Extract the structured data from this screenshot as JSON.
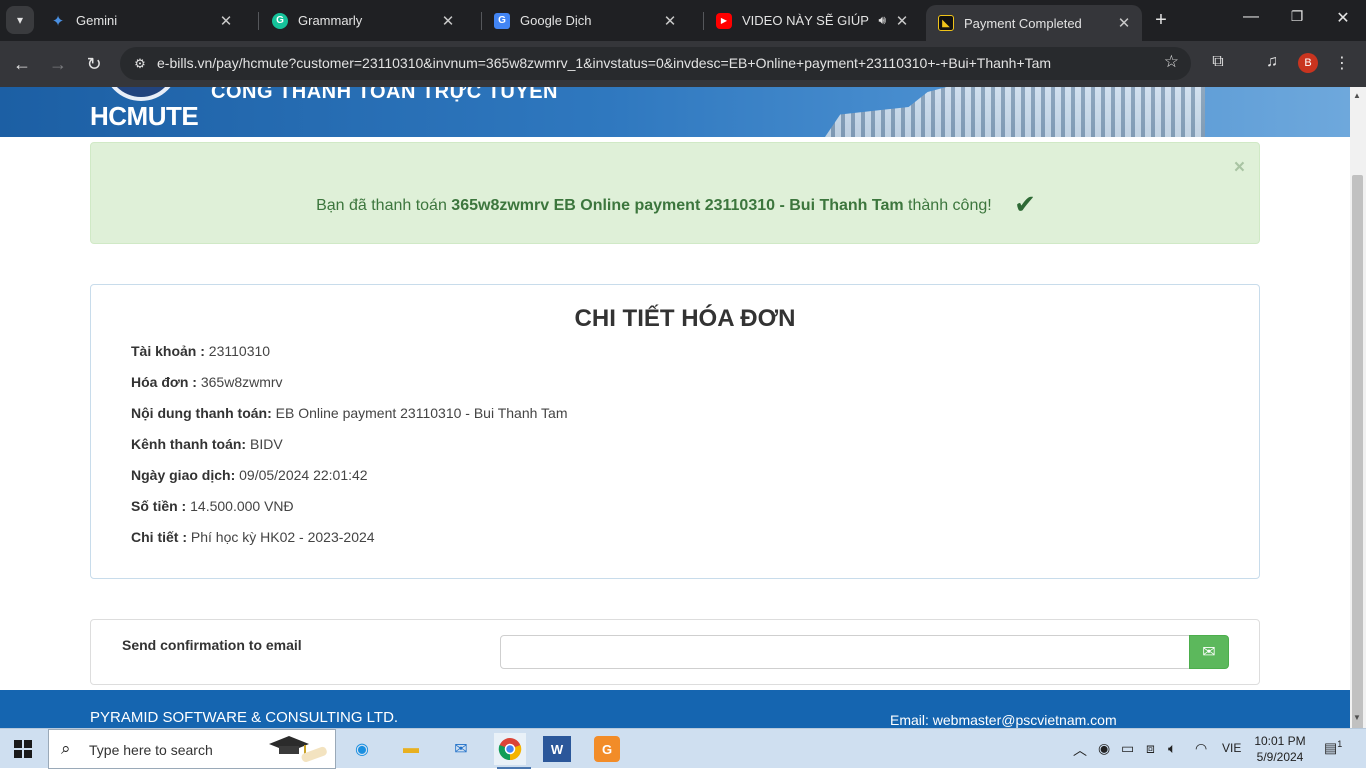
{
  "browser": {
    "tabs": [
      {
        "label": "Gemini",
        "icon": "gemini-sparkle-icon",
        "color": "#4a90e2",
        "active": false
      },
      {
        "label": "Grammarly",
        "icon": "grammarly-icon",
        "color": "#15c39a",
        "active": false
      },
      {
        "label": "Google Dịch",
        "icon": "google-translate-icon",
        "color": "#4285f4",
        "active": false
      },
      {
        "label": "VIDEO NÀY SẼ GIÚP BẠN",
        "icon": "youtube-icon",
        "color": "#ff0000",
        "active": false,
        "audio": true
      },
      {
        "label": "Payment Completed",
        "icon": "site-favicon",
        "color": "#f0c419",
        "active": true
      }
    ],
    "url": "e-bills.vn/pay/hcmute?customer=23110310&invnum=365w8zwmrv_1&invstatus=0&invdesc=EB+Online+payment+23110310+-+Bui+Thanh+Tam",
    "profile_initial": "B",
    "accent": "#35363a"
  },
  "banner": {
    "brand": "HCMUTE",
    "portal_title": "CỔNG THANH TOÁN TRỰC TUYẾN"
  },
  "alert": {
    "prefix": "Bạn đã thanh toán ",
    "bold": "365w8zwmrv EB Online payment 23110310 - Bui Thanh Tam",
    "suffix": " thành công!",
    "close": "×",
    "color": "#3c763d"
  },
  "invoice": {
    "title": "CHI TIẾT HÓA ĐƠN",
    "rows": [
      {
        "label": "Tài khoản :",
        "value": "23110310"
      },
      {
        "label": "Hóa đơn :",
        "value": "365w8zwmrv"
      },
      {
        "label": "Nội dung thanh toán:",
        "value": "EB Online payment 23110310 - Bui Thanh Tam"
      },
      {
        "label": "Kênh thanh toán:",
        "value": "BIDV"
      },
      {
        "label": "Ngày giao dịch:",
        "value": "09/05/2024 22:01:42"
      },
      {
        "label": "Số tiền :",
        "value": "14.500.000 VNĐ"
      },
      {
        "label": "Chi tiết :",
        "value": "Phí học kỳ HK02 - 2023-2024"
      }
    ]
  },
  "email": {
    "label": "Send confirmation to email",
    "value": "",
    "button_color": "#5cb85c"
  },
  "footer": {
    "company": "PYRAMID SOFTWARE & CONSULTING LTD.",
    "email": "Email: webmaster@pscvietnam.com",
    "color": "#1565b0"
  },
  "taskbar": {
    "search_placeholder": "Type here to search",
    "language": "VIE",
    "time": "10:01 PM",
    "date": "5/9/2024",
    "notifications": "1"
  }
}
